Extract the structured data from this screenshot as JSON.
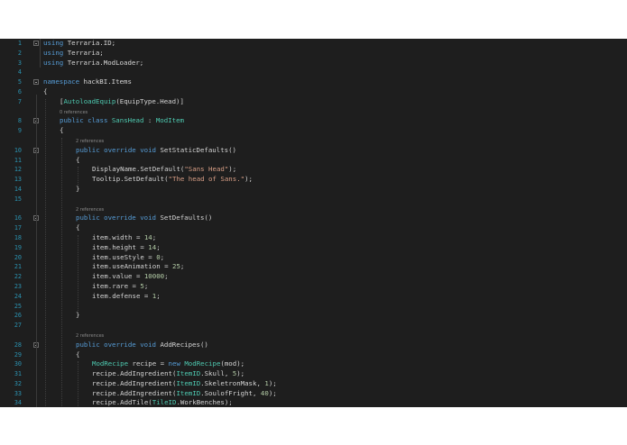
{
  "editor": {
    "lines": [
      {
        "n": "1",
        "lens": false,
        "fold": true,
        "indent": 0,
        "tokens": [
          [
            "k",
            "using"
          ],
          [
            "p",
            " Terraria.ID;"
          ]
        ]
      },
      {
        "n": "2",
        "lens": false,
        "fold": false,
        "indent": 0,
        "tokens": [
          [
            "k",
            "using"
          ],
          [
            "p",
            " Terraria;"
          ]
        ]
      },
      {
        "n": "3",
        "lens": false,
        "fold": false,
        "indent": 0,
        "tokens": [
          [
            "k",
            "using"
          ],
          [
            "p",
            " Terraria.ModLoader;"
          ]
        ]
      },
      {
        "n": "4",
        "lens": false,
        "fold": false,
        "indent": 0,
        "tokens": []
      },
      {
        "n": "5",
        "lens": false,
        "fold": true,
        "indent": 0,
        "tokens": [
          [
            "k",
            "namespace"
          ],
          [
            "p",
            " hackBI.Items"
          ]
        ]
      },
      {
        "n": "6",
        "lens": false,
        "fold": false,
        "indent": 0,
        "tokens": [
          [
            "p",
            "{"
          ]
        ]
      },
      {
        "n": "7",
        "lens": false,
        "fold": false,
        "indent": 1,
        "tokens": [
          [
            "p",
            "["
          ],
          [
            "t",
            "AutoloadEquip"
          ],
          [
            "p",
            "(EquipType.Head)]"
          ]
        ]
      },
      {
        "n": "",
        "lens": true,
        "fold": false,
        "indent": 1,
        "tokens": [
          [
            "lens",
            "0 references"
          ]
        ]
      },
      {
        "n": "8",
        "lens": false,
        "fold": true,
        "indent": 1,
        "tokens": [
          [
            "k",
            "public class "
          ],
          [
            "t",
            "SansHead"
          ],
          [
            "p",
            " : "
          ],
          [
            "t",
            "ModItem"
          ]
        ]
      },
      {
        "n": "9",
        "lens": false,
        "fold": false,
        "indent": 1,
        "tokens": [
          [
            "p",
            "{"
          ]
        ]
      },
      {
        "n": "",
        "lens": true,
        "fold": false,
        "indent": 2,
        "tokens": [
          [
            "lens",
            "2 references"
          ]
        ]
      },
      {
        "n": "10",
        "lens": false,
        "fold": true,
        "indent": 2,
        "tokens": [
          [
            "k",
            "public override void "
          ],
          [
            "p",
            "SetStaticDefaults()"
          ]
        ]
      },
      {
        "n": "11",
        "lens": false,
        "fold": false,
        "indent": 2,
        "tokens": [
          [
            "p",
            "{"
          ]
        ]
      },
      {
        "n": "12",
        "lens": false,
        "fold": false,
        "indent": 3,
        "tokens": [
          [
            "p",
            "DisplayName.SetDefault("
          ],
          [
            "s",
            "\"Sans Head\""
          ],
          [
            "p",
            ");"
          ]
        ]
      },
      {
        "n": "13",
        "lens": false,
        "fold": false,
        "indent": 3,
        "tokens": [
          [
            "p",
            "Tooltip.SetDefault("
          ],
          [
            "s",
            "\"The head of Sans.\""
          ],
          [
            "p",
            ");"
          ]
        ]
      },
      {
        "n": "14",
        "lens": false,
        "fold": false,
        "indent": 2,
        "tokens": [
          [
            "p",
            "}"
          ]
        ]
      },
      {
        "n": "15",
        "lens": false,
        "fold": false,
        "indent": 0,
        "tokens": []
      },
      {
        "n": "",
        "lens": true,
        "fold": false,
        "indent": 2,
        "tokens": [
          [
            "lens",
            "2 references"
          ]
        ]
      },
      {
        "n": "16",
        "lens": false,
        "fold": true,
        "indent": 2,
        "tokens": [
          [
            "k",
            "public override void "
          ],
          [
            "p",
            "SetDefaults()"
          ]
        ]
      },
      {
        "n": "17",
        "lens": false,
        "fold": false,
        "indent": 2,
        "tokens": [
          [
            "p",
            "{"
          ]
        ]
      },
      {
        "n": "18",
        "lens": false,
        "fold": false,
        "indent": 3,
        "tokens": [
          [
            "p",
            "item.width = "
          ],
          [
            "n",
            "14"
          ],
          [
            "p",
            ";"
          ]
        ]
      },
      {
        "n": "19",
        "lens": false,
        "fold": false,
        "indent": 3,
        "tokens": [
          [
            "p",
            "item.height = "
          ],
          [
            "n",
            "14"
          ],
          [
            "p",
            ";"
          ]
        ]
      },
      {
        "n": "20",
        "lens": false,
        "fold": false,
        "indent": 3,
        "tokens": [
          [
            "p",
            "item.useStyle = "
          ],
          [
            "n",
            "0"
          ],
          [
            "p",
            ";"
          ]
        ]
      },
      {
        "n": "21",
        "lens": false,
        "fold": false,
        "indent": 3,
        "tokens": [
          [
            "p",
            "item.useAnimation = "
          ],
          [
            "n",
            "25"
          ],
          [
            "p",
            ";"
          ]
        ]
      },
      {
        "n": "22",
        "lens": false,
        "fold": false,
        "indent": 3,
        "tokens": [
          [
            "p",
            "item.value = "
          ],
          [
            "n",
            "10000"
          ],
          [
            "p",
            ";"
          ]
        ]
      },
      {
        "n": "23",
        "lens": false,
        "fold": false,
        "indent": 3,
        "tokens": [
          [
            "p",
            "item.rare = "
          ],
          [
            "n",
            "5"
          ],
          [
            "p",
            ";"
          ]
        ]
      },
      {
        "n": "24",
        "lens": false,
        "fold": false,
        "indent": 3,
        "tokens": [
          [
            "p",
            "item.defense = "
          ],
          [
            "n",
            "1"
          ],
          [
            "p",
            ";"
          ]
        ]
      },
      {
        "n": "25",
        "lens": false,
        "fold": false,
        "indent": 0,
        "tokens": []
      },
      {
        "n": "26",
        "lens": false,
        "fold": false,
        "indent": 2,
        "tokens": [
          [
            "p",
            "}"
          ]
        ]
      },
      {
        "n": "27",
        "lens": false,
        "fold": false,
        "indent": 0,
        "tokens": []
      },
      {
        "n": "",
        "lens": true,
        "fold": false,
        "indent": 2,
        "tokens": [
          [
            "lens",
            "2 references"
          ]
        ]
      },
      {
        "n": "28",
        "lens": false,
        "fold": true,
        "indent": 2,
        "tokens": [
          [
            "k",
            "public override void "
          ],
          [
            "p",
            "AddRecipes()"
          ]
        ]
      },
      {
        "n": "29",
        "lens": false,
        "fold": false,
        "indent": 2,
        "tokens": [
          [
            "p",
            "{"
          ]
        ]
      },
      {
        "n": "30",
        "lens": false,
        "fold": false,
        "indent": 3,
        "tokens": [
          [
            "t",
            "ModRecipe"
          ],
          [
            "p",
            " recipe = "
          ],
          [
            "k",
            "new "
          ],
          [
            "t",
            "ModRecipe"
          ],
          [
            "p",
            "(mod);"
          ]
        ]
      },
      {
        "n": "31",
        "lens": false,
        "fold": false,
        "indent": 3,
        "tokens": [
          [
            "p",
            "recipe.AddIngredient("
          ],
          [
            "t",
            "ItemID"
          ],
          [
            "p",
            ".Skull, "
          ],
          [
            "n",
            "5"
          ],
          [
            "p",
            ");"
          ]
        ]
      },
      {
        "n": "32",
        "lens": false,
        "fold": false,
        "indent": 3,
        "tokens": [
          [
            "p",
            "recipe.AddIngredient("
          ],
          [
            "t",
            "ItemID"
          ],
          [
            "p",
            ".SkeletronMask, "
          ],
          [
            "n",
            "1"
          ],
          [
            "p",
            ");"
          ]
        ]
      },
      {
        "n": "33",
        "lens": false,
        "fold": false,
        "indent": 3,
        "tokens": [
          [
            "p",
            "recipe.AddIngredient("
          ],
          [
            "t",
            "ItemID"
          ],
          [
            "p",
            ".SoulofFright, "
          ],
          [
            "n",
            "40"
          ],
          [
            "p",
            ");"
          ]
        ]
      },
      {
        "n": "34",
        "lens": false,
        "fold": false,
        "indent": 3,
        "tokens": [
          [
            "p",
            "recipe.AddTile("
          ],
          [
            "t",
            "TileID"
          ],
          [
            "p",
            ".WorkBenches);"
          ]
        ]
      }
    ]
  }
}
